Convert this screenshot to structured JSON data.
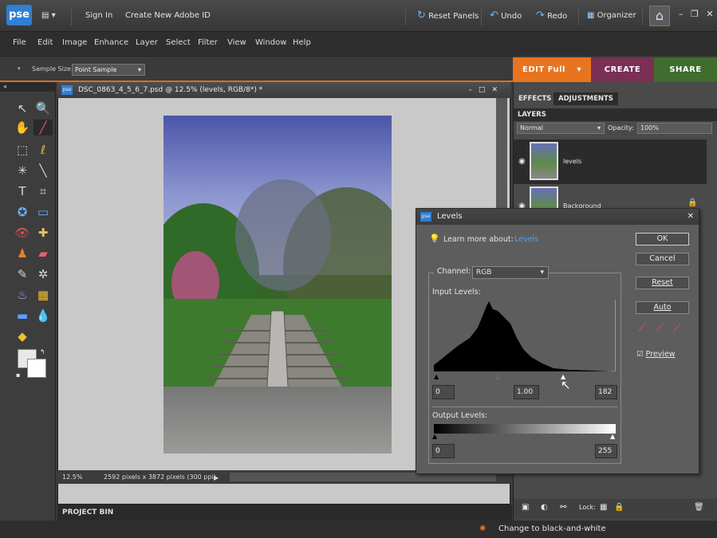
{
  "app": {
    "logo": "pse",
    "sign_in": "Sign In",
    "create_id": "Create New Adobe ID",
    "reset_panels": "Reset Panels",
    "undo": "Undo",
    "redo": "Redo",
    "organizer": "Organizer"
  },
  "menu": [
    "File",
    "Edit",
    "Image",
    "Enhance",
    "Layer",
    "Select",
    "Filter",
    "View",
    "Window",
    "Help"
  ],
  "options": {
    "sample_size_label": "Sample Size:",
    "sample_size_value": "Point Sample"
  },
  "modes": {
    "edit": "EDIT Full",
    "create": "CREATE",
    "share": "SHARE"
  },
  "document": {
    "title": "DSC_0863_4_5_6_7.psd @ 12.5% (levels, RGB/8*) *",
    "zoom": "12.5%",
    "dimensions": "2592 pixels x 3872 pixels (300 ppi)"
  },
  "project_bin": "PROJECT BIN",
  "panels": {
    "effects": "EFFECTS",
    "adjustments": "ADJUSTMENTS",
    "layers": "LAYERS",
    "blend_mode": "Normal",
    "opacity_label": "Opacity:",
    "opacity_value": "100%",
    "layer_items": [
      {
        "name": "levels"
      },
      {
        "name": "Background"
      }
    ],
    "lock_label": "Lock:"
  },
  "levels": {
    "title": "Levels",
    "learn_more": "Learn more about:",
    "learn_more_link": "Levels",
    "ok": "OK",
    "cancel": "Cancel",
    "reset": "Reset",
    "auto": "Auto",
    "preview": "Preview",
    "channel_label": "Channel:",
    "channel_value": "RGB",
    "input_levels": "Input Levels:",
    "output_levels": "Output Levels:",
    "input_black": "0",
    "input_gamma": "1.00",
    "input_white": "182",
    "output_black": "0",
    "output_white": "255"
  },
  "status_message": "Change to black-and-white",
  "colors": {
    "accent_orange": "#e8741f",
    "create_purple": "#7a2f55",
    "share_green": "#3f6d2d",
    "link_blue": "#4ea0ff"
  }
}
